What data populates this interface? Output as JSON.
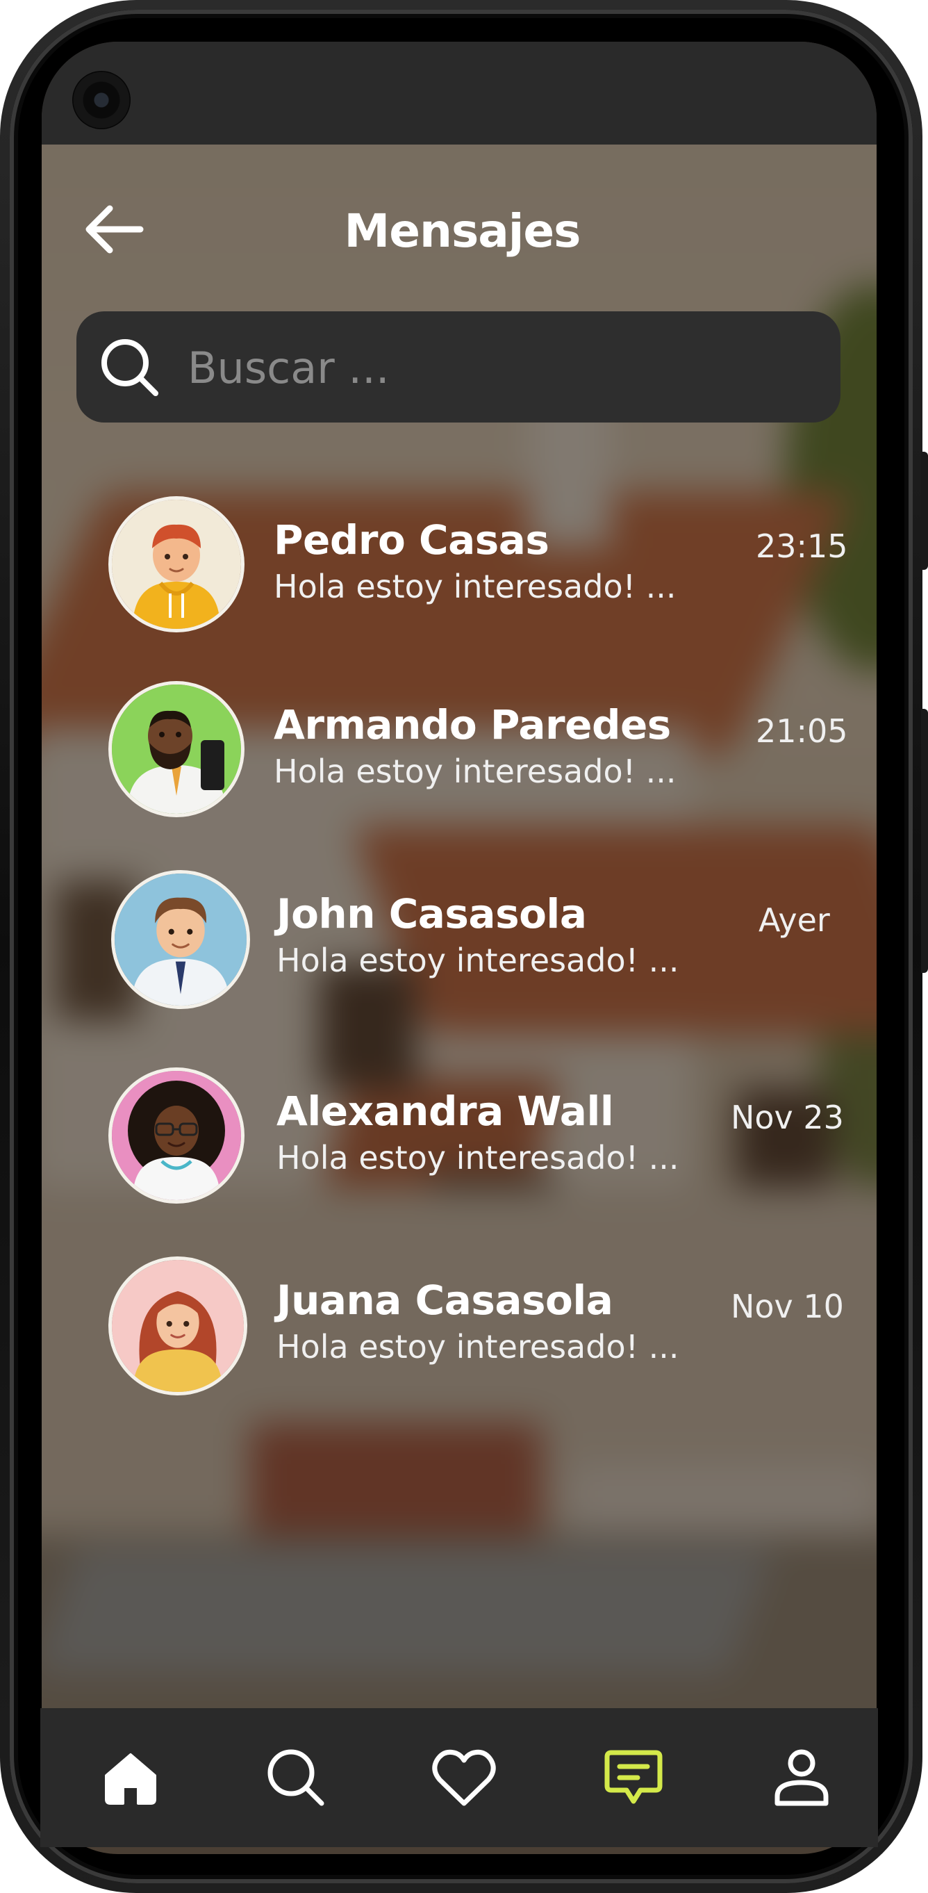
{
  "header": {
    "title": "Mensajes",
    "back_icon": "arrow-left-icon"
  },
  "search": {
    "placeholder": "Buscar ...",
    "value": "",
    "icon": "search-icon"
  },
  "chats": [
    {
      "name": "Pedro Casas",
      "preview": "Hola estoy interesado! ...",
      "time": "23:15",
      "avatar": "avatar-boy-yellow-hoodie"
    },
    {
      "name": "Armando Paredes",
      "preview": "Hola estoy interesado! ...",
      "time": "21:05",
      "avatar": "avatar-man-beard-phone"
    },
    {
      "name": "John Casasola",
      "preview": "Hola estoy interesado! ...",
      "time": "Ayer",
      "avatar": "avatar-man-shirt-tie"
    },
    {
      "name": "Alexandra Wall",
      "preview": "Hola estoy interesado! ...",
      "time": "Nov 23",
      "avatar": "avatar-woman-curly-glasses"
    },
    {
      "name": "Juana Casasola",
      "preview": "Hola estoy interesado! ...",
      "time": "Nov 10",
      "avatar": "avatar-woman-red-hair"
    }
  ],
  "bottom_nav": {
    "items": [
      {
        "icon": "home-icon",
        "active": false
      },
      {
        "icon": "search-icon",
        "active": false
      },
      {
        "icon": "heart-icon",
        "active": false
      },
      {
        "icon": "chat-icon",
        "active": true
      },
      {
        "icon": "profile-icon",
        "active": false
      }
    ],
    "active_color": "#d4e94a",
    "inactive_color": "#ffffff"
  },
  "colors": {
    "nav_background": "#2a2a2a",
    "search_background": "#2e2e2e"
  }
}
